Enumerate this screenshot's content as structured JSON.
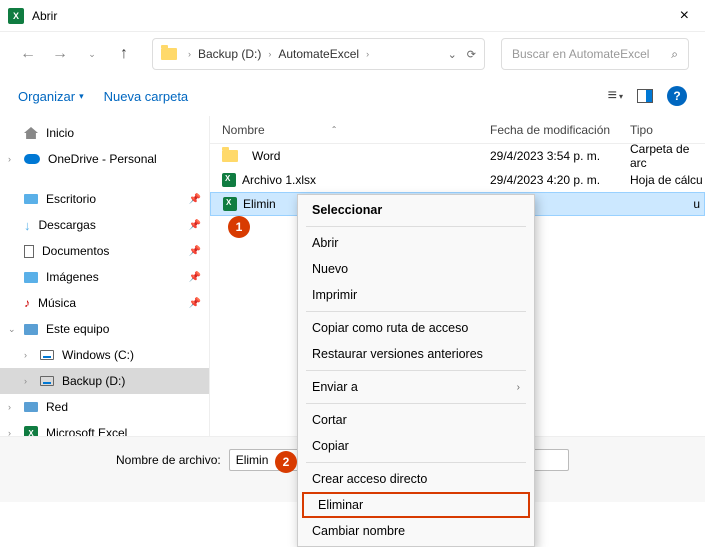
{
  "titlebar": {
    "title": "Abrir"
  },
  "nav": {
    "crumb1": "Backup (D:)",
    "crumb2": "AutomateExcel",
    "searchPlaceholder": "Buscar en AutomateExcel"
  },
  "toolbar": {
    "organize": "Organizar",
    "newFolder": "Nueva carpeta"
  },
  "sidebar": {
    "home": "Inicio",
    "onedrive": "OneDrive - Personal",
    "desktop": "Escritorio",
    "downloads": "Descargas",
    "documents": "Documentos",
    "images": "Imágenes",
    "music": "Música",
    "thispc": "Este equipo",
    "cdrive": "Windows (C:)",
    "ddrive": "Backup (D:)",
    "network": "Red",
    "excel": "Microsoft Excel"
  },
  "columns": {
    "name": "Nombre",
    "date": "Fecha de modificación",
    "type": "Tipo"
  },
  "rows": [
    {
      "name": "Word",
      "date": "29/4/2023 3:54 p. m.",
      "type": "Carpeta de arc"
    },
    {
      "name": "Archivo 1.xlsx",
      "date": "29/4/2023 4:20 p. m.",
      "type": "Hoja de cálcu"
    },
    {
      "name": "Elimin",
      "date": "",
      "type": "u"
    }
  ],
  "ctx": {
    "select": "Seleccionar",
    "open": "Abrir",
    "new": "Nuevo",
    "print": "Imprimir",
    "copyPath": "Copiar como ruta de acceso",
    "restore": "Restaurar versiones anteriores",
    "sendTo": "Enviar a",
    "cut": "Cortar",
    "copy": "Copiar",
    "shortcut": "Crear acceso directo",
    "delete": "Eliminar",
    "rename": "Cambiar nombre"
  },
  "bottom": {
    "label": "Nombre de archivo:",
    "value": "Elimin"
  },
  "badges": {
    "b1": "1",
    "b2": "2"
  }
}
